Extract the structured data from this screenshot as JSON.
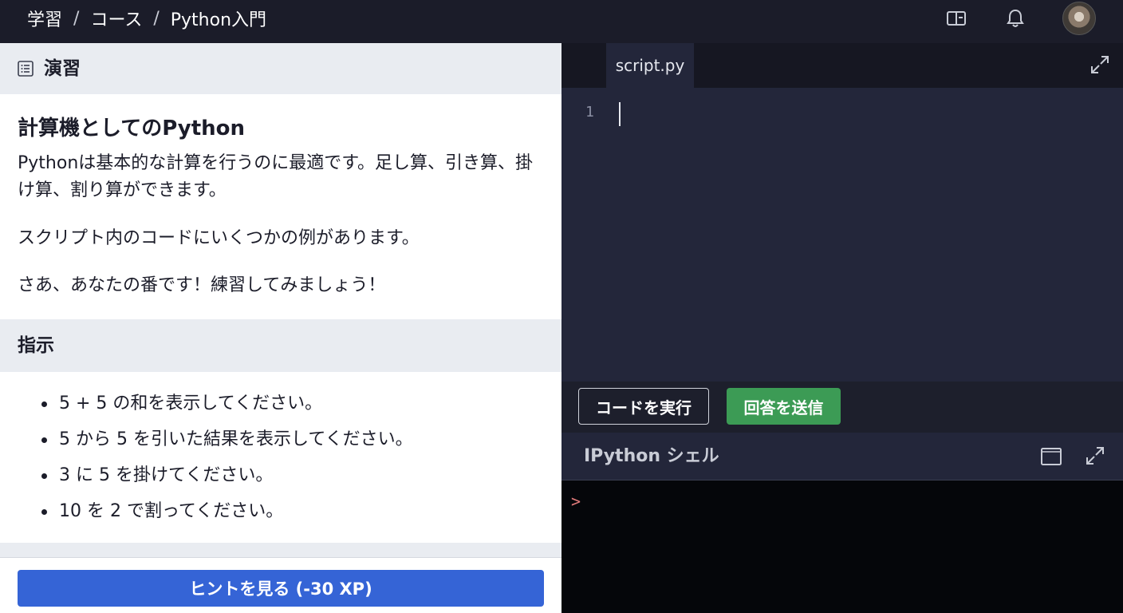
{
  "breadcrumb": {
    "items": [
      "学習",
      "コース",
      "Python入門"
    ],
    "separator": "/"
  },
  "topbar": {
    "icons": [
      "book-open-icon",
      "bell-icon"
    ],
    "avatar": "user-avatar"
  },
  "exercise": {
    "section_label": "演習",
    "title": "計算機としてのPython",
    "paragraphs": [
      "Pythonは基本的な計算を行うのに最適です。足し算、引き算、掛け算、割り算ができます。",
      "スクリプト内のコードにいくつかの例があります。",
      "さあ、あなたの番です！練習してみましょう！"
    ]
  },
  "instructions": {
    "section_label": "指示",
    "items": [
      "5 + 5 の和を表示してください。",
      "5 から 5 を引いた結果を表示してください。",
      "3 に 5 を掛けてください。",
      "10 を 2 で割ってください。"
    ]
  },
  "hint_button": "ヒントを見る (-30 XP)",
  "editor": {
    "tab": "script.py",
    "line_number": "1",
    "content": ""
  },
  "buttons": {
    "run": "コードを実行",
    "submit": "回答を送信"
  },
  "shell": {
    "title": "IPython シェル",
    "prompt": ">"
  },
  "colors": {
    "topbar": "#1b1c29",
    "hint_blue": "#3564d6",
    "submit_green": "#3c9b55",
    "editor_bg": "#23263a",
    "console_bg": "#05060a"
  }
}
